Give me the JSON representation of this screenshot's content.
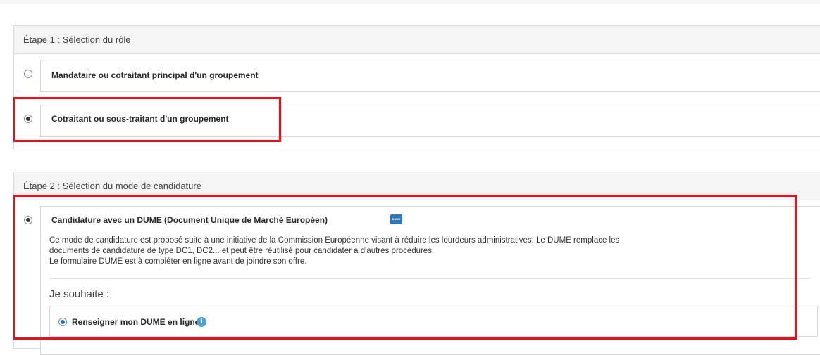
{
  "step1": {
    "title": "Étape 1 : Sélection du rôle",
    "options": [
      {
        "label": "Mandataire ou cotraitant principal d'un groupement",
        "selected": false
      },
      {
        "label": "Cotraitant ou sous-traitant d'un groupement",
        "selected": true
      }
    ]
  },
  "step2": {
    "title": "Étape 2 : Sélection du mode de candidature",
    "dume_option": {
      "label": "Candidature avec un DUME (Document Unique de Marché Européen)",
      "badge": "DUME",
      "selected": true,
      "description_line1": "Ce mode de candidature est proposé suite à une initiative de la Commission Européenne visant à réduire les lourdeurs administratives. Le DUME remplace les",
      "description_line2": "documents de candidature de type DC1, DC2... et peut être réutilisé pour candidater à d'autres procédures.",
      "description_line3": "Le formulaire DUME est à compléter en ligne avant de joindre son offre."
    },
    "je_souhaite": "Je souhaite :",
    "sub_option": {
      "label": "Renseigner mon DUME en ligne",
      "selected": true,
      "info_icon": "i"
    }
  },
  "colors": {
    "highlight": "#e8101a",
    "accent": "#2a6db5",
    "badge": "#2f77b8",
    "info": "#4aa3d8"
  },
  "icons": [
    "radio-unchecked",
    "radio-checked",
    "dume-logo-icon",
    "info-icon"
  ]
}
